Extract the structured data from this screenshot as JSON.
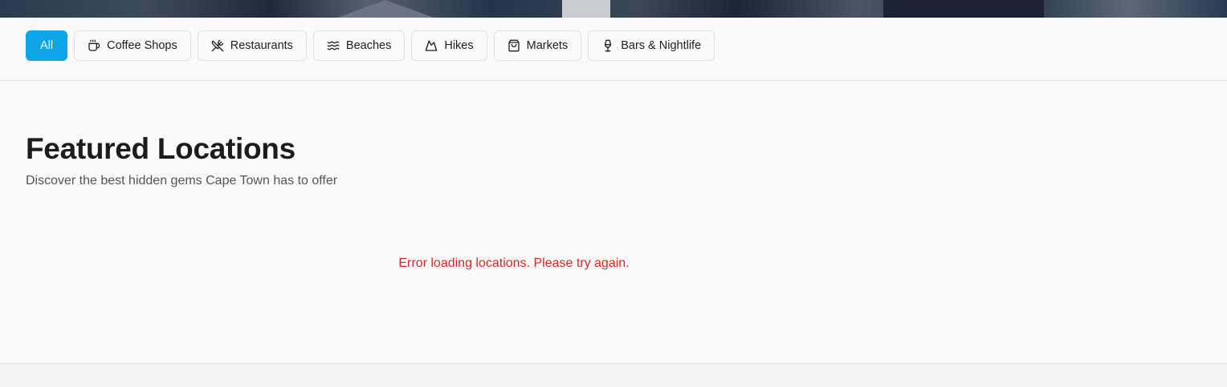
{
  "filters": {
    "items": [
      {
        "label": "All",
        "icon": "none",
        "active": true
      },
      {
        "label": "Coffee Shops",
        "icon": "coffee-icon",
        "active": false
      },
      {
        "label": "Restaurants",
        "icon": "utensils-crossed-icon",
        "active": false
      },
      {
        "label": "Beaches",
        "icon": "waves-icon",
        "active": false
      },
      {
        "label": "Hikes",
        "icon": "mountain-icon",
        "active": false
      },
      {
        "label": "Markets",
        "icon": "shopping-bag-icon",
        "active": false
      },
      {
        "label": "Bars & Nightlife",
        "icon": "wine-icon",
        "active": false
      }
    ]
  },
  "featured": {
    "title": "Featured Locations",
    "subtitle": "Discover the best hidden gems Cape Town has to offer",
    "error_message": "Error loading locations. Please try again."
  },
  "colors": {
    "accent": "#0ea5e9",
    "error": "#dc2626",
    "background": "#fafafa"
  }
}
